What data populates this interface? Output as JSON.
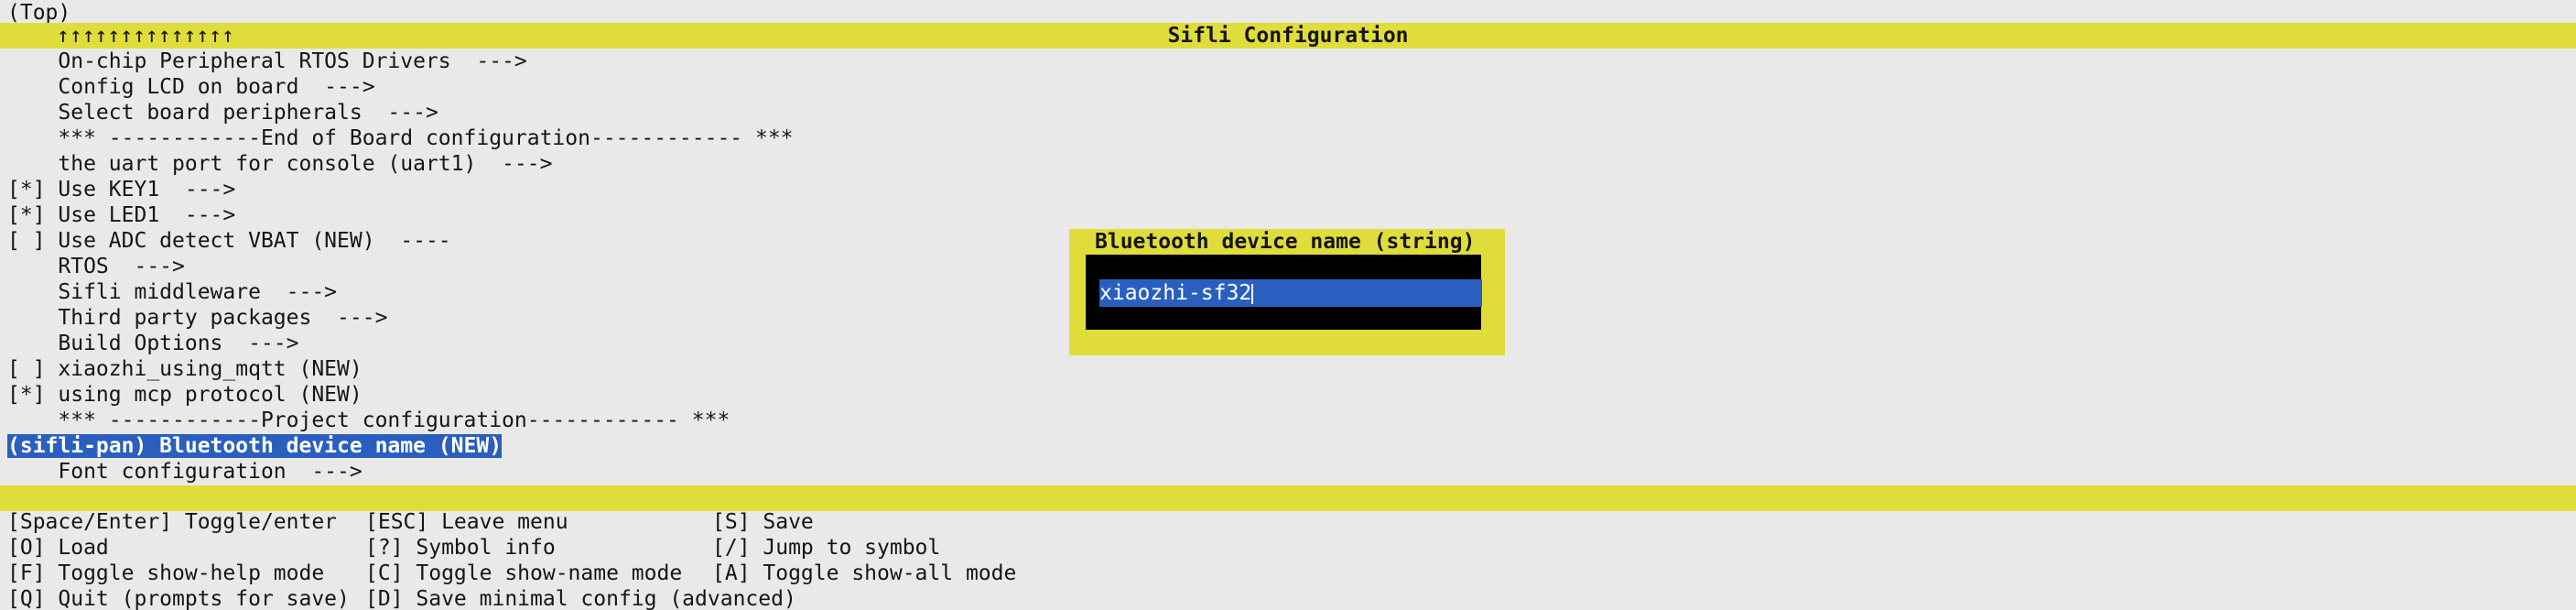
{
  "header": {
    "location": "(Top)",
    "arrows": "↑↑↑↑↑↑↑↑↑↑↑↑↑↑",
    "title": "Sifli Configuration"
  },
  "menu": {
    "items": [
      "    On-chip Peripheral RTOS Drivers  --->",
      "    Config LCD on board  --->",
      "    Select board peripherals  --->",
      "    *** ------------End of Board configuration------------ ***",
      "    the uart port for console (uart1)  --->",
      "[*] Use KEY1  --->",
      "[*] Use LED1  --->",
      "[ ] Use ADC detect VBAT (NEW)  ----",
      "    RTOS  --->",
      "    Sifli middleware  --->",
      "    Third party packages  --->",
      "    Build Options  --->",
      "[ ] xiaozhi_using_mqtt (NEW)",
      "[*] using mcp protocol (NEW)",
      "    *** ------------Project configuration------------ ***",
      "(sifli-pan) Bluetooth device name (NEW)",
      "    Font configuration  --->"
    ],
    "selected_index": 15
  },
  "dialog": {
    "title": "Bluetooth device name (string)",
    "value": "xiaozhi-sf32"
  },
  "help": {
    "rows": [
      [
        "[Space/Enter] Toggle/enter",
        "[ESC] Leave menu",
        "[S] Save"
      ],
      [
        "[O] Load",
        "[?] Symbol info",
        "[/] Jump to symbol"
      ],
      [
        "[F] Toggle show-help mode",
        "[C] Toggle show-name mode",
        "[A] Toggle show-all mode"
      ],
      [
        "[Q] Quit (prompts for save)",
        "[D] Save minimal config (advanced)",
        ""
      ]
    ]
  },
  "colors": {
    "background": "#e9e9e9",
    "accent_yellow": "#e0dd3a",
    "selection_blue": "#2a5fbf",
    "text": "#151515"
  }
}
